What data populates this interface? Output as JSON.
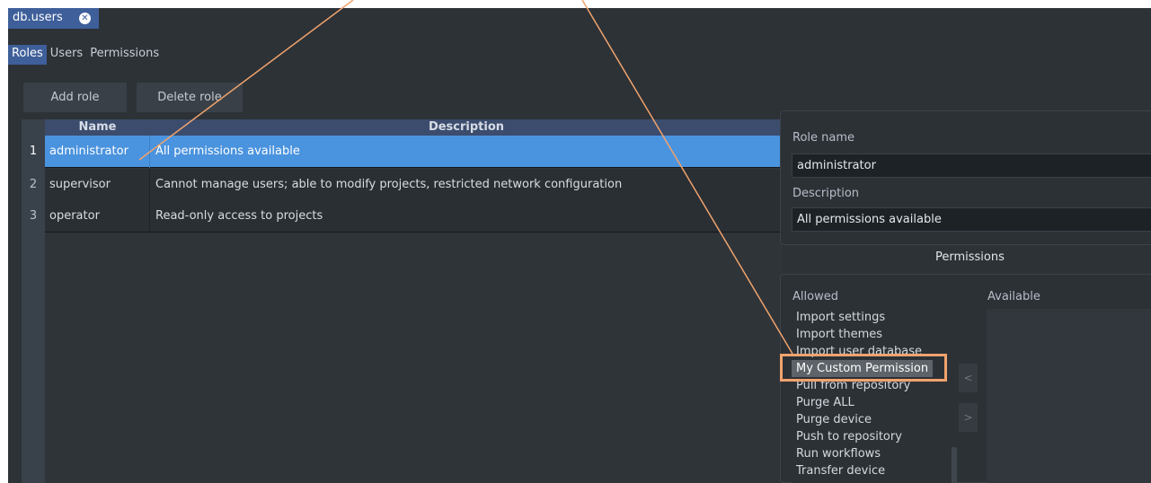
{
  "document_tab": {
    "label": "db.users",
    "close_glyph": "✕"
  },
  "subtabs": [
    {
      "label": "Roles",
      "active": true
    },
    {
      "label": "Users",
      "active": false
    },
    {
      "label": "Permissions",
      "active": false
    }
  ],
  "toolbar": {
    "add_role_label": "Add role",
    "delete_role_label": "Delete role"
  },
  "roles_table": {
    "columns": [
      "Name",
      "Description"
    ],
    "rows": [
      {
        "num": "1",
        "name": "administrator",
        "description": "All permissions available",
        "selected": true
      },
      {
        "num": "2",
        "name": "supervisor",
        "description": "Cannot manage users; able to modify projects, restricted network configuration",
        "selected": false
      },
      {
        "num": "3",
        "name": "operator",
        "description": "Read-only access to projects",
        "selected": false
      }
    ]
  },
  "role_details": {
    "role_name_label": "Role name",
    "role_name_value": "administrator",
    "description_label": "Description",
    "description_value": "All permissions available"
  },
  "permissions": {
    "heading": "Permissions",
    "allowed_label": "Allowed",
    "available_label": "Available",
    "allowed_items": [
      "Import settings",
      "Import themes",
      "Import user database",
      "My Custom Permission",
      "Pull from repository",
      "Purge ALL",
      "Purge device",
      "Push to repository",
      "Run workflows",
      "Transfer device"
    ],
    "selected_item": "My Custom Permission",
    "move_left_glyph": "<",
    "move_right_glyph": ">"
  },
  "colors": {
    "accent": "#3e5f9a",
    "selection": "#4a93de",
    "callout": "#f0a36c",
    "background": "#2d3237"
  }
}
